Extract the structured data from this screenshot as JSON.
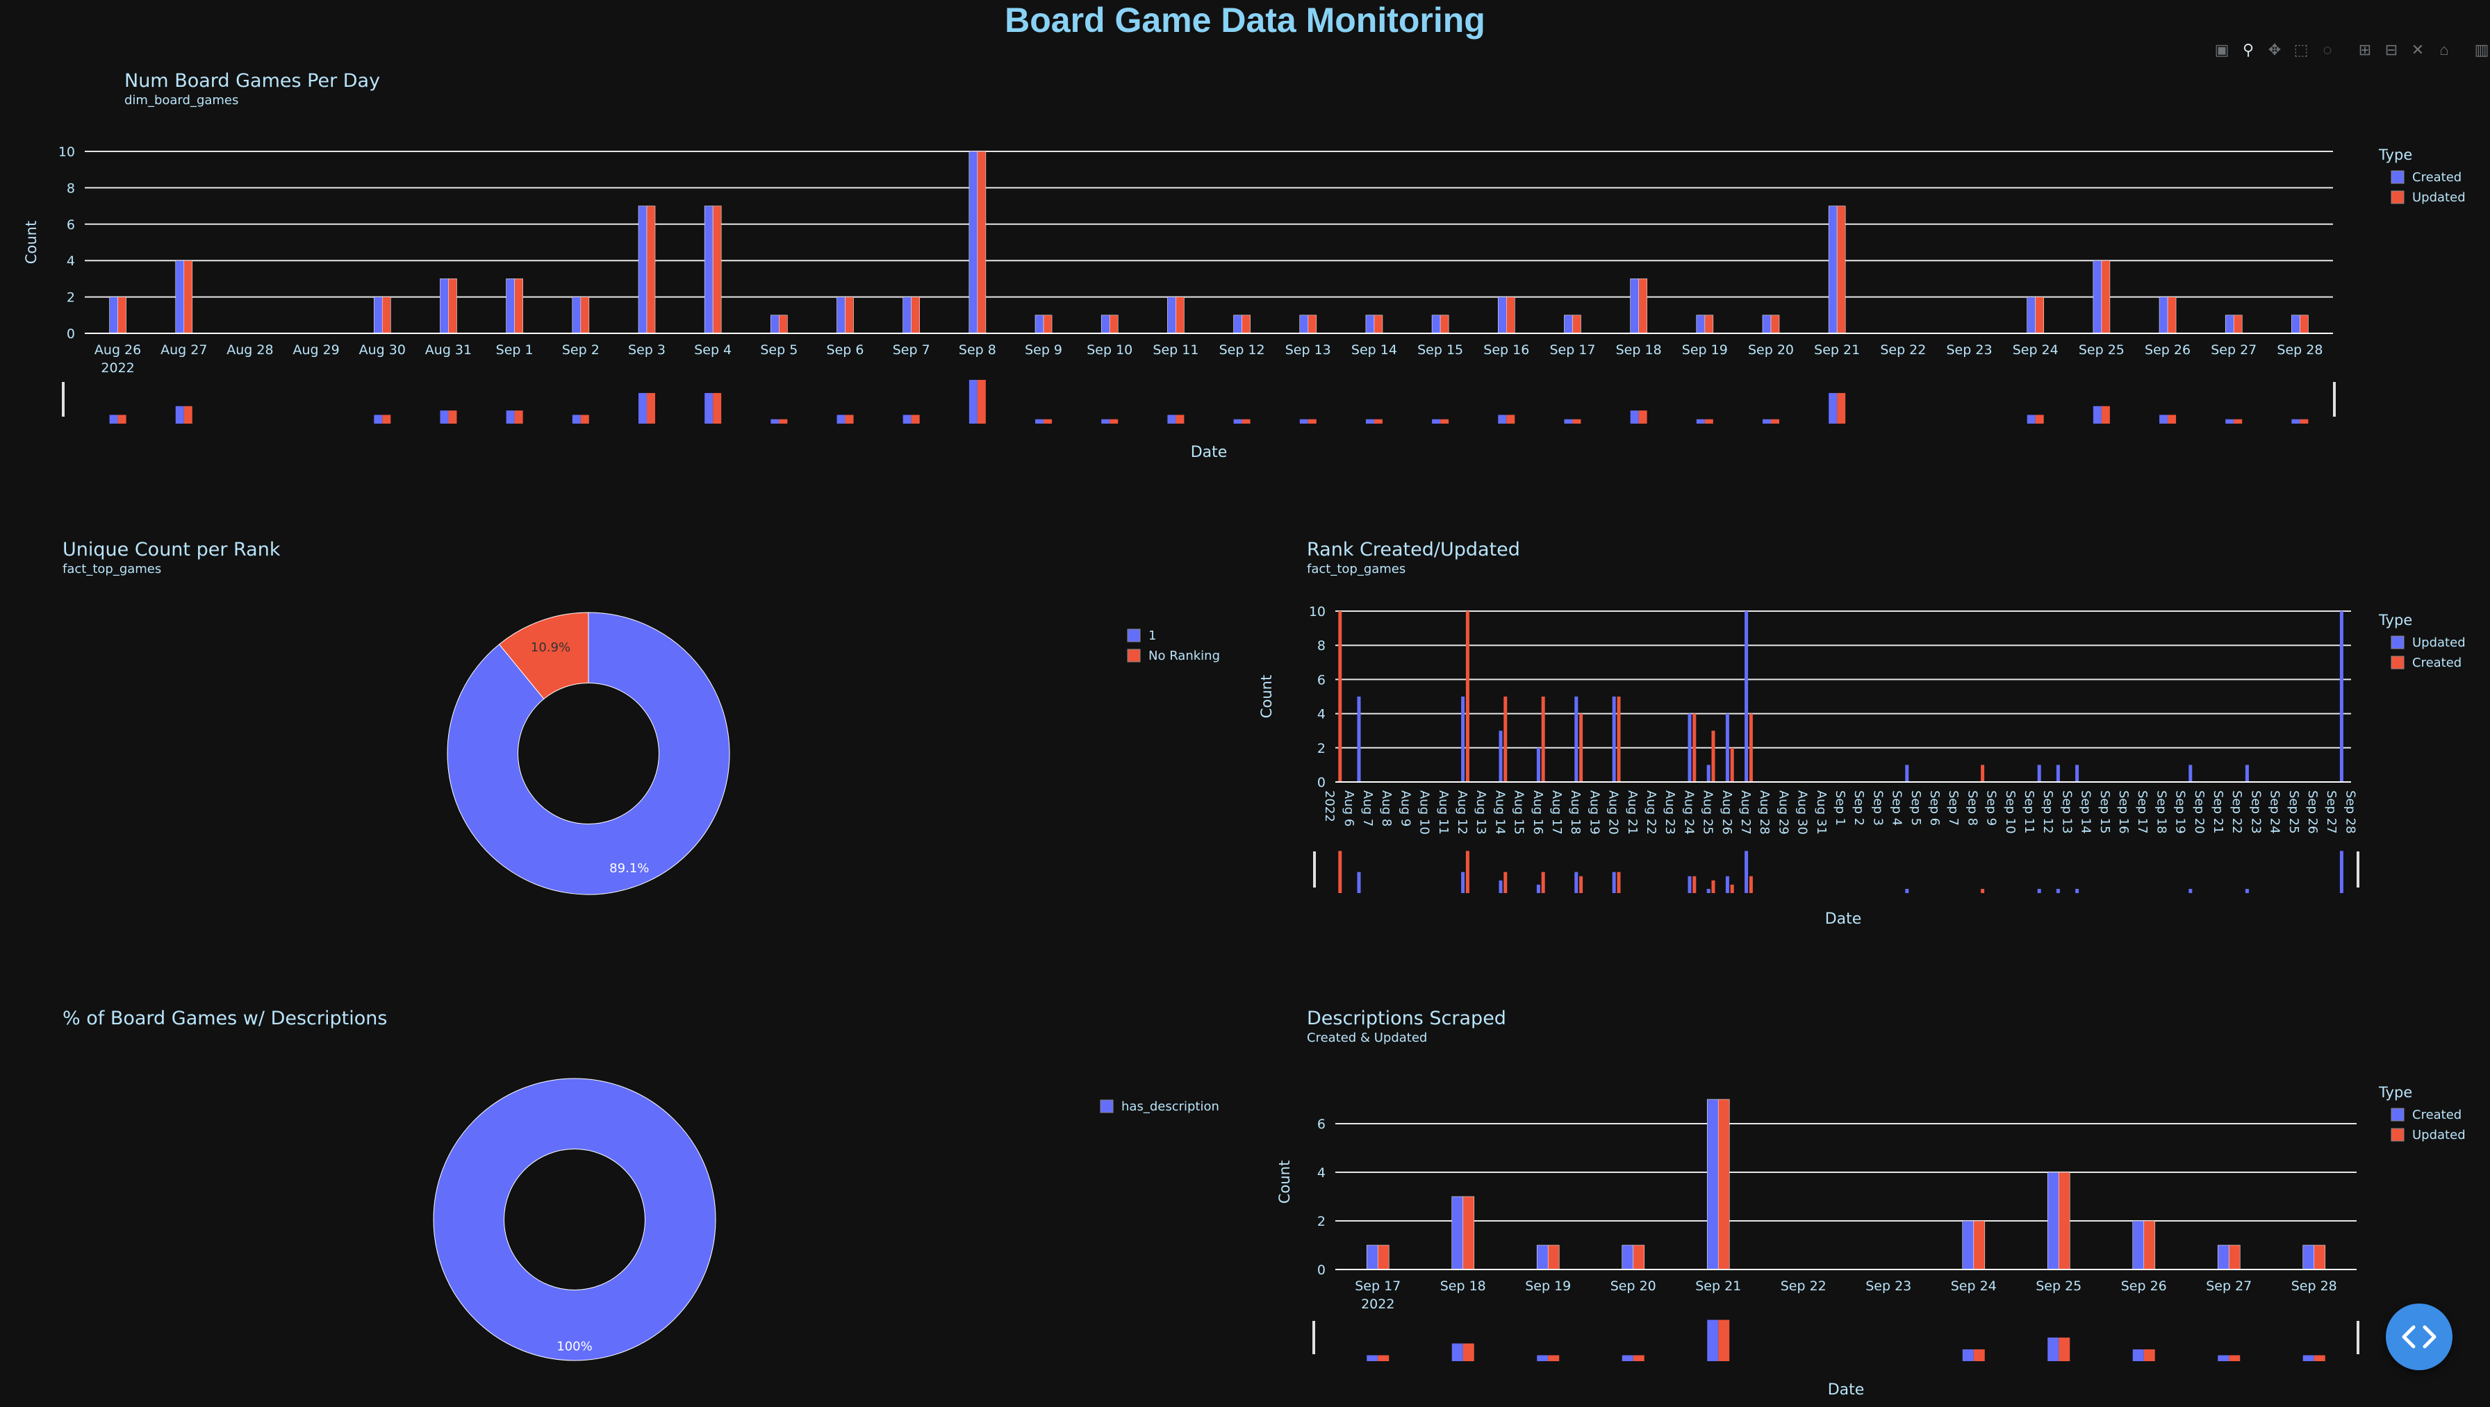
{
  "page": {
    "title": "Board Game Data Monitoring"
  },
  "colors": {
    "background": "#111111",
    "text": "#b9e4fa",
    "grid": "#ffffff",
    "created": "#636efa",
    "updated": "#ef553b",
    "title": "#89d2f5",
    "fab": "#3b8de6"
  },
  "modebar": {
    "icons": [
      "camera-icon",
      "zoom-icon",
      "pan-icon",
      "box-select-icon",
      "lasso-icon",
      "zoom-in-icon",
      "zoom-out-icon",
      "autoscale-icon",
      "reset-axes-icon",
      "plotly-logo-icon"
    ]
  },
  "fab": {
    "icon": "code-icon"
  },
  "chart_data": [
    {
      "id": "num_board_games",
      "type": "bar",
      "title": "Num Board Games Per Day",
      "subtitle": "dim_board_games",
      "xlabel": "Date",
      "ylabel": "Count",
      "ylim": [
        0,
        10
      ],
      "yticks": [
        0,
        2,
        4,
        6,
        8,
        10
      ],
      "year_label": "2022",
      "legend_title": "Type",
      "legend_position": "right",
      "grid": true,
      "range_slider": true,
      "categories": [
        "Aug 26",
        "Aug 27",
        "Aug 28",
        "Aug 29",
        "Aug 30",
        "Aug 31",
        "Sep 1",
        "Sep 2",
        "Sep 3",
        "Sep 4",
        "Sep 5",
        "Sep 6",
        "Sep 7",
        "Sep 8",
        "Sep 9",
        "Sep 10",
        "Sep 11",
        "Sep 12",
        "Sep 13",
        "Sep 14",
        "Sep 15",
        "Sep 16",
        "Sep 17",
        "Sep 18",
        "Sep 19",
        "Sep 20",
        "Sep 21",
        "Sep 22",
        "Sep 23",
        "Sep 24",
        "Sep 25",
        "Sep 26",
        "Sep 27",
        "Sep 28"
      ],
      "series": [
        {
          "name": "Created",
          "color": "#636efa",
          "values": [
            2,
            4,
            0,
            0,
            2,
            3,
            3,
            2,
            7,
            7,
            1,
            2,
            2,
            10,
            1,
            1,
            2,
            1,
            1,
            1,
            1,
            2,
            1,
            3,
            1,
            1,
            7,
            0,
            0,
            2,
            4,
            2,
            1,
            1
          ]
        },
        {
          "name": "Updated",
          "color": "#ef553b",
          "values": [
            2,
            4,
            0,
            0,
            2,
            3,
            3,
            2,
            7,
            7,
            1,
            2,
            2,
            10,
            1,
            1,
            2,
            1,
            1,
            1,
            1,
            2,
            1,
            3,
            1,
            1,
            7,
            0,
            0,
            2,
            4,
            2,
            1,
            1
          ]
        }
      ]
    },
    {
      "id": "unique_count_per_rank",
      "type": "pie",
      "title": "Unique Count per Rank",
      "subtitle": "fact_top_games",
      "hole": 0.5,
      "labels": [
        "1",
        "No Ranking"
      ],
      "values": [
        89.1,
        10.9
      ],
      "text_labels": [
        "89.1%",
        "10.9%"
      ],
      "colors": [
        "#636efa",
        "#ef553b"
      ],
      "legend_position": "right"
    },
    {
      "id": "rank_created_updated",
      "type": "bar",
      "title": "Rank Created/Updated",
      "subtitle": "fact_top_games",
      "xlabel": "Date",
      "ylabel": "Count",
      "ylim": [
        0,
        10
      ],
      "yticks": [
        0,
        2,
        4,
        6,
        8,
        10
      ],
      "year_label": "2022",
      "legend_title": "Type",
      "legend_position": "right",
      "grid": true,
      "range_slider": true,
      "categories": [
        "Aug 6",
        "Aug 7",
        "Aug 8",
        "Aug 9",
        "Aug 10",
        "Aug 11",
        "Aug 12",
        "Aug 13",
        "Aug 14",
        "Aug 15",
        "Aug 16",
        "Aug 17",
        "Aug 18",
        "Aug 19",
        "Aug 20",
        "Aug 21",
        "Aug 22",
        "Aug 23",
        "Aug 24",
        "Aug 25",
        "Aug 26",
        "Aug 27",
        "Aug 28",
        "Aug 29",
        "Aug 30",
        "Aug 31",
        "Sep 1",
        "Sep 2",
        "Sep 3",
        "Sep 4",
        "Sep 5",
        "Sep 6",
        "Sep 7",
        "Sep 8",
        "Sep 9",
        "Sep 10",
        "Sep 11",
        "Sep 12",
        "Sep 13",
        "Sep 14",
        "Sep 15",
        "Sep 16",
        "Sep 17",
        "Sep 18",
        "Sep 19",
        "Sep 20",
        "Sep 21",
        "Sep 22",
        "Sep 23",
        "Sep 24",
        "Sep 25",
        "Sep 26",
        "Sep 27",
        "Sep 28"
      ],
      "series": [
        {
          "name": "Updated",
          "color": "#636efa",
          "points": [
            {
              "x": "2022-08-06T12:00",
              "y": 0
            },
            {
              "x": "2022-08-07T00:00",
              "y": 5
            },
            {
              "x": "2022-08-12T12:00",
              "y": 5
            },
            {
              "x": "2022-08-14T12:00",
              "y": 3
            },
            {
              "x": "2022-08-16T12:00",
              "y": 2
            },
            {
              "x": "2022-08-18T12:00",
              "y": 5
            },
            {
              "x": "2022-08-20T12:00",
              "y": 5
            },
            {
              "x": "2022-08-24T12:00",
              "y": 4
            },
            {
              "x": "2022-08-25T12:00",
              "y": 1
            },
            {
              "x": "2022-08-26T12:00",
              "y": 4
            },
            {
              "x": "2022-08-27T12:00",
              "y": 10
            },
            {
              "x": "2022-09-05T00:00",
              "y": 1
            },
            {
              "x": "2022-09-12T00:00",
              "y": 1
            },
            {
              "x": "2022-09-13T00:00",
              "y": 1
            },
            {
              "x": "2022-09-14T00:00",
              "y": 1
            },
            {
              "x": "2022-09-20T00:00",
              "y": 1
            },
            {
              "x": "2022-09-23T00:00",
              "y": 1
            },
            {
              "x": "2022-09-28T00:00",
              "y": 10
            }
          ]
        },
        {
          "name": "Created",
          "color": "#ef553b",
          "points": [
            {
              "x": "2022-08-06T00:00",
              "y": 10
            },
            {
              "x": "2022-08-12T18:00",
              "y": 10
            },
            {
              "x": "2022-08-14T18:00",
              "y": 5
            },
            {
              "x": "2022-08-16T18:00",
              "y": 5
            },
            {
              "x": "2022-08-18T18:00",
              "y": 4
            },
            {
              "x": "2022-08-20T18:00",
              "y": 5
            },
            {
              "x": "2022-08-24T18:00",
              "y": 4
            },
            {
              "x": "2022-08-25T18:00",
              "y": 3
            },
            {
              "x": "2022-08-26T18:00",
              "y": 2
            },
            {
              "x": "2022-08-27T18:00",
              "y": 4
            },
            {
              "x": "2022-09-09T00:00",
              "y": 1
            }
          ]
        }
      ]
    },
    {
      "id": "pct_with_descriptions",
      "type": "pie",
      "title": "% of Board Games w/ Descriptions",
      "subtitle": "",
      "hole": 0.5,
      "labels": [
        "has_description"
      ],
      "values": [
        100
      ],
      "text_labels": [
        "100%"
      ],
      "colors": [
        "#636efa"
      ],
      "legend_position": "right"
    },
    {
      "id": "descriptions_scraped",
      "type": "bar",
      "title": "Descriptions Scraped",
      "subtitle": "Created & Updated",
      "xlabel": "Date",
      "ylabel": "Count",
      "ylim": [
        0,
        7.2
      ],
      "yticks": [
        0,
        2,
        4,
        6
      ],
      "year_label": "2022",
      "legend_title": "Type",
      "legend_position": "right",
      "grid": true,
      "range_slider": true,
      "categories": [
        "Sep 17",
        "Sep 18",
        "Sep 19",
        "Sep 20",
        "Sep 21",
        "Sep 22",
        "Sep 23",
        "Sep 24",
        "Sep 25",
        "Sep 26",
        "Sep 27",
        "Sep 28"
      ],
      "series": [
        {
          "name": "Created",
          "color": "#636efa",
          "values": [
            1,
            3,
            1,
            1,
            7,
            0,
            0,
            2,
            4,
            2,
            1,
            1
          ]
        },
        {
          "name": "Updated",
          "color": "#ef553b",
          "values": [
            1,
            3,
            1,
            1,
            7,
            0,
            0,
            2,
            4,
            2,
            1,
            1
          ]
        }
      ]
    }
  ]
}
